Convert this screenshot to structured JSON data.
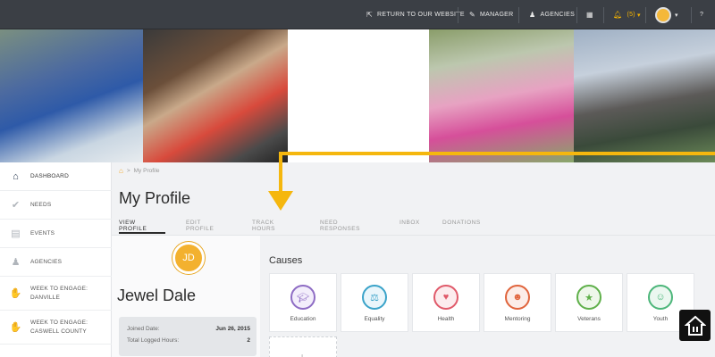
{
  "topbar": {
    "return_label": "RETURN TO OUR WEBSITE",
    "manager_label": "MANAGER",
    "agencies_label": "AGENCIES",
    "notifications_count": "(5)",
    "help_label": "?"
  },
  "breadcrumb": {
    "current": "My Profile"
  },
  "page_title": "My Profile",
  "tabs": [
    {
      "label": "VIEW PROFILE"
    },
    {
      "label": "EDIT PROFILE"
    },
    {
      "label": "TRACK HOURS"
    },
    {
      "label": "NEED RESPONSES"
    },
    {
      "label": "INBOX"
    },
    {
      "label": "DONATIONS"
    }
  ],
  "sidebar": {
    "items": [
      {
        "label": "DASHBOARD",
        "icon": "home-icon"
      },
      {
        "label": "NEEDS",
        "icon": "check-circle-icon"
      },
      {
        "label": "EVENTS",
        "icon": "calendar-icon"
      },
      {
        "label": "AGENCIES",
        "icon": "users-icon"
      },
      {
        "label": "WEEK TO ENGAGE: DANVILLE",
        "icon": "handshake-icon"
      },
      {
        "label": "WEEK TO ENGAGE: CASWELL COUNTY",
        "icon": "handshake-icon"
      }
    ]
  },
  "profile": {
    "initials": "JD",
    "name": "Jewel Dale",
    "joined_label": "Joined Date:",
    "joined_value": "Jun 26, 2015",
    "hours_label": "Total Logged Hours:",
    "hours_value": "2"
  },
  "causes": {
    "title": "Causes",
    "items": [
      {
        "label": "Education",
        "icon": "graduation-cap-icon",
        "color": "#8e6cc4"
      },
      {
        "label": "Equality",
        "icon": "scales-icon",
        "color": "#3aa3c9"
      },
      {
        "label": "Health",
        "icon": "heart-icon",
        "color": "#e05a6a"
      },
      {
        "label": "Mentoring",
        "icon": "mentor-icon",
        "color": "#e0643c"
      },
      {
        "label": "Veterans",
        "icon": "star-shield-icon",
        "color": "#5fb04a"
      },
      {
        "label": "Youth",
        "icon": "children-icon",
        "color": "#4cb67a"
      }
    ]
  },
  "colors": {
    "accent": "#f5b70e",
    "topbar": "#3b3f45",
    "navy": "#1f3048"
  }
}
